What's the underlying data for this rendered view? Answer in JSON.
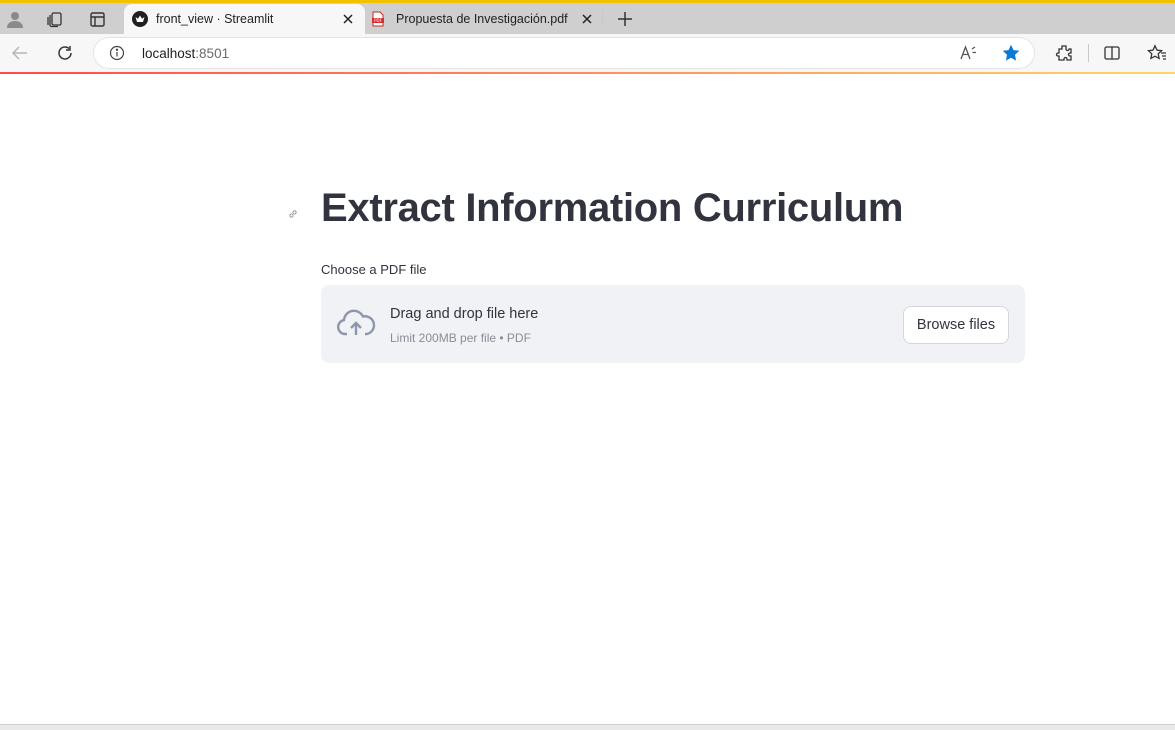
{
  "browser": {
    "tabs": [
      {
        "title": "front_view · Streamlit",
        "active": true,
        "icon": "streamlit-icon"
      },
      {
        "title": "Propuesta de Investigación.pdf",
        "active": false,
        "icon": "pdf-icon"
      }
    ],
    "address": {
      "host": "localhost",
      "port": ":8501"
    },
    "colors": {
      "accent_top": "#f2c200",
      "favorite_star": "#0a7ad6"
    }
  },
  "page": {
    "title": "Extract Information Curriculum",
    "uploader": {
      "label": "Choose a PDF file",
      "drop_text": "Drag and drop file here",
      "limit_text": "Limit 200MB per file • PDF",
      "browse_label": "Browse files"
    }
  }
}
